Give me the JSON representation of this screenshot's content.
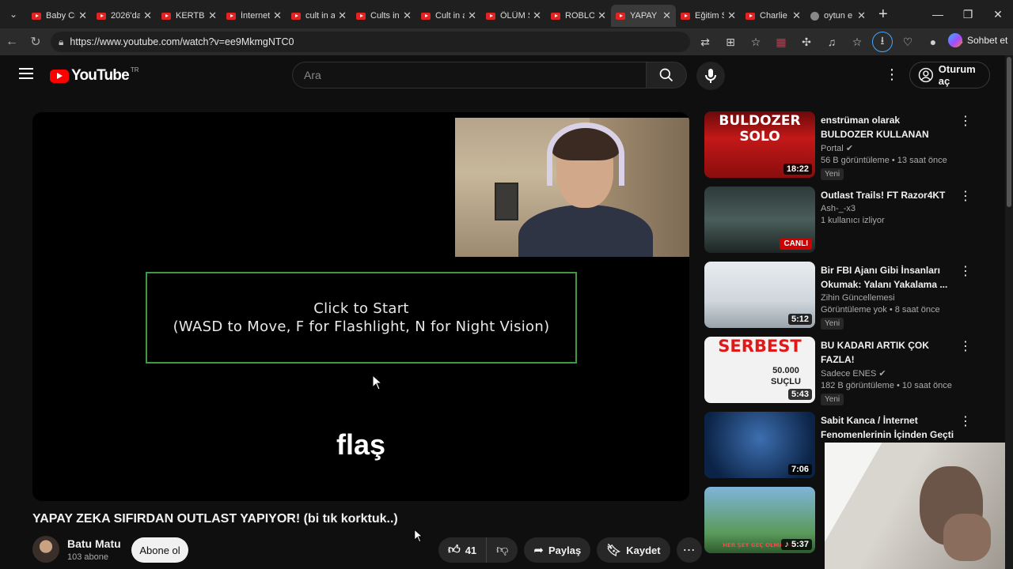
{
  "browser": {
    "tabs": [
      {
        "label": "Baby Cr",
        "favicon": "youtube-icon"
      },
      {
        "label": "2026'da",
        "favicon": "youtube-icon"
      },
      {
        "label": "KERTB",
        "favicon": "youtube-icon"
      },
      {
        "label": "İnternet",
        "favicon": "youtube-icon"
      },
      {
        "label": "cult in a",
        "favicon": "youtube-icon"
      },
      {
        "label": "Cults in",
        "favicon": "youtube-icon"
      },
      {
        "label": "Cult in a",
        "favicon": "youtube-icon"
      },
      {
        "label": "ÖLÜM S",
        "favicon": "youtube-icon"
      },
      {
        "label": "ROBLOX",
        "favicon": "youtube-icon"
      },
      {
        "label": "YAPAY Z",
        "favicon": "youtube-icon",
        "active": true
      },
      {
        "label": "Eğitim S",
        "favicon": "youtube-icon"
      },
      {
        "label": "Charlie",
        "favicon": "youtube-icon"
      },
      {
        "label": "oytun e",
        "favicon": "google-icon"
      }
    ],
    "url": "https://www.youtube.com/watch?v=ee9MkmgNTC0",
    "copilot_label": "Sohbet et"
  },
  "header": {
    "logo_text": "YouTube",
    "country": "TR",
    "search_placeholder": "Ara",
    "signin_label": "Oturum aç"
  },
  "player": {
    "start_line1": "Click to Start",
    "start_line2": "(WASD to Move, F for Flashlight, N for Night Vision)",
    "caption": "flaş"
  },
  "video": {
    "title": "YAPAY ZEKA SIFIRDAN OUTLAST YAPIYOR! (bi tık korktuk..)",
    "channel_name": "Batu Matu",
    "channel_subs": "103 abone",
    "subscribe_label": "Abone ol",
    "likes": "41",
    "share_label": "Paylaş",
    "save_label": "Kaydet"
  },
  "recommendations": [
    {
      "title": "enstrüman olarak BULDOZER KULLANAN DELİMANYAK ...",
      "channel": "Portal",
      "verified": true,
      "stats": "56 B görüntüleme • 13 saat önce",
      "badge": "Yeni",
      "duration": "18:22",
      "thumb_text": "BULDOZER SOLO"
    },
    {
      "title": "Outlast Trails! FT Razor4KT",
      "channel": "Ash-_-x3",
      "stats": "1 kullanıcı izliyor",
      "live_label": "CANLI"
    },
    {
      "title": "Bir FBI Ajanı Gibi İnsanları Okumak: Yalanı Yakalama ...",
      "channel": "Zihin Güncellemesi",
      "stats": "Görüntüleme yok • 8 saat önce",
      "badge": "Yeni",
      "duration": "5:12"
    },
    {
      "title": "BU KADARI ARTIK ÇOK FAZLA!",
      "channel": "Sadece ENES",
      "verified": true,
      "stats": "182 B görüntüleme • 10 saat önce",
      "badge": "Yeni",
      "duration": "5:43",
      "thumb_text": "SERBEST",
      "thumb_text2": "50.000 SUÇLU"
    },
    {
      "title": "Sabit Kanca / İnternet Fenomenlerinin İçinden Geçti",
      "duration": "7:06"
    },
    {
      "title": "",
      "duration": "5:37",
      "thumb_text": "HER ŞEY GEÇ OLMADAN"
    }
  ]
}
